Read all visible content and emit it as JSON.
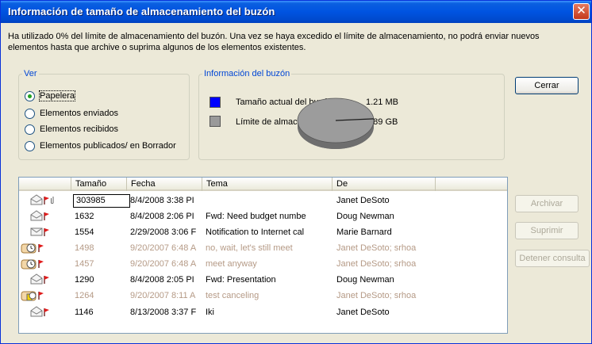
{
  "window": {
    "title": "Información de tamaño de almacenamiento del buzón",
    "close_glyph": "✕"
  },
  "description": "Ha utilizado 0% del límite de almacenamiento del buzón. Una vez se haya excedido el límite de almacenamiento, no podrá enviar nuevos elementos hasta que archive o suprima algunos de los elementos existentes.",
  "view": {
    "legend": "Ver",
    "options": [
      {
        "label": "Papelera",
        "selected": true
      },
      {
        "label": "Elementos enviados",
        "selected": false
      },
      {
        "label": "Elementos recibidos",
        "selected": false
      },
      {
        "label": "Elementos publicados/ en Borrador",
        "selected": false
      }
    ]
  },
  "mailbox_info": {
    "legend": "Información del buzón",
    "current_size_label": "Tamaño actual del buzón:",
    "current_size_value": "1.21 MB",
    "current_size_color": "#0000ff",
    "limit_label": "Límite de almacenamiento a",
    "limit_value": "1.89 GB",
    "limit_color": "#9a9a9a",
    "used_fraction": 0.0006
  },
  "buttons": {
    "close": "Cerrar",
    "archive": "Archivar",
    "delete": "Suprimir",
    "stop_query": "Detener consulta"
  },
  "table": {
    "columns": [
      "Tamaño",
      "Fecha",
      "Tema",
      "De"
    ],
    "rows": [
      {
        "icons": "envelope-open, flag, attachment",
        "size": "303985",
        "date": "8/4/2008 3:38 PI",
        "subject": "",
        "from": "Janet DeSoto",
        "dim": false,
        "selected": true
      },
      {
        "icons": "envelope-open, flag",
        "size": "1632",
        "date": "8/4/2008 2:06 PI",
        "subject": "Fwd: Need budget numbe",
        "from": "Doug Newman",
        "dim": false
      },
      {
        "icons": "envelope, flag",
        "size": "1554",
        "date": "2/29/2008 3:06 F",
        "subject": "Notification to Internet cal",
        "from": "Marie Barnard",
        "dim": false
      },
      {
        "icons": "meeting-clock-orange, flag",
        "size": "1498",
        "date": "9/20/2007 6:48 A",
        "subject": "no, wait, let's still meet",
        "from": "Janet DeSoto;  srhoa",
        "dim": true
      },
      {
        "icons": "meeting-clock, flag",
        "size": "1457",
        "date": "9/20/2007 6:48 A",
        "subject": "meet anyway",
        "from": "Janet DeSoto;  srhoa",
        "dim": true
      },
      {
        "icons": "envelope-open, flag",
        "size": "1290",
        "date": "8/4/2008 2:05 PI",
        "subject": "Fwd: Presentation",
        "from": "Doug Newman",
        "dim": false
      },
      {
        "icons": "meeting-canceled, flag",
        "size": "1264",
        "date": "9/20/2007 8:11 A",
        "subject": "test canceling",
        "from": "Janet DeSoto;  srhoa",
        "dim": true
      },
      {
        "icons": "envelope-open, flag",
        "size": "1146",
        "date": "8/13/2008 3:37 F",
        "subject": "Iki",
        "from": "Janet DeSoto",
        "dim": false
      }
    ]
  }
}
